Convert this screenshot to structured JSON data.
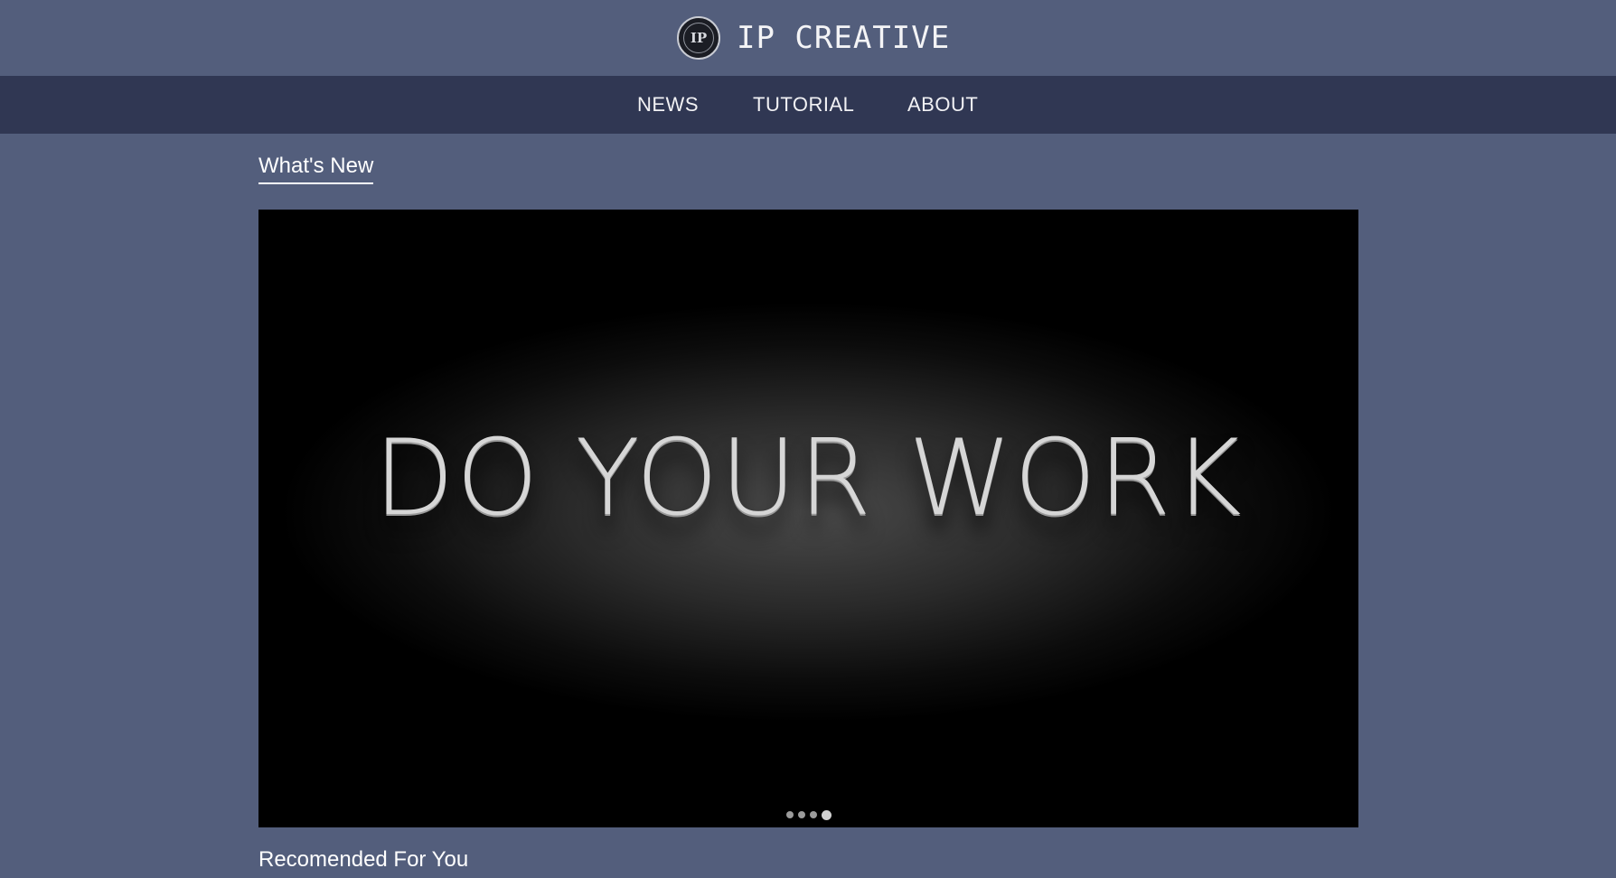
{
  "header": {
    "logo_text": "IP",
    "brand_title": "IP CREATIVE"
  },
  "nav": {
    "items": [
      {
        "label": "NEWS"
      },
      {
        "label": "TUTORIAL"
      },
      {
        "label": "ABOUT"
      }
    ]
  },
  "main": {
    "whats_new_title": "What's New",
    "slider": {
      "slide_text": "DO YOUR WORK",
      "slide_count": 4,
      "active_slide": 4
    },
    "recommended_title": "Recomended For You"
  },
  "colors": {
    "page_background": "#535e7c",
    "nav_background": "#303753"
  }
}
